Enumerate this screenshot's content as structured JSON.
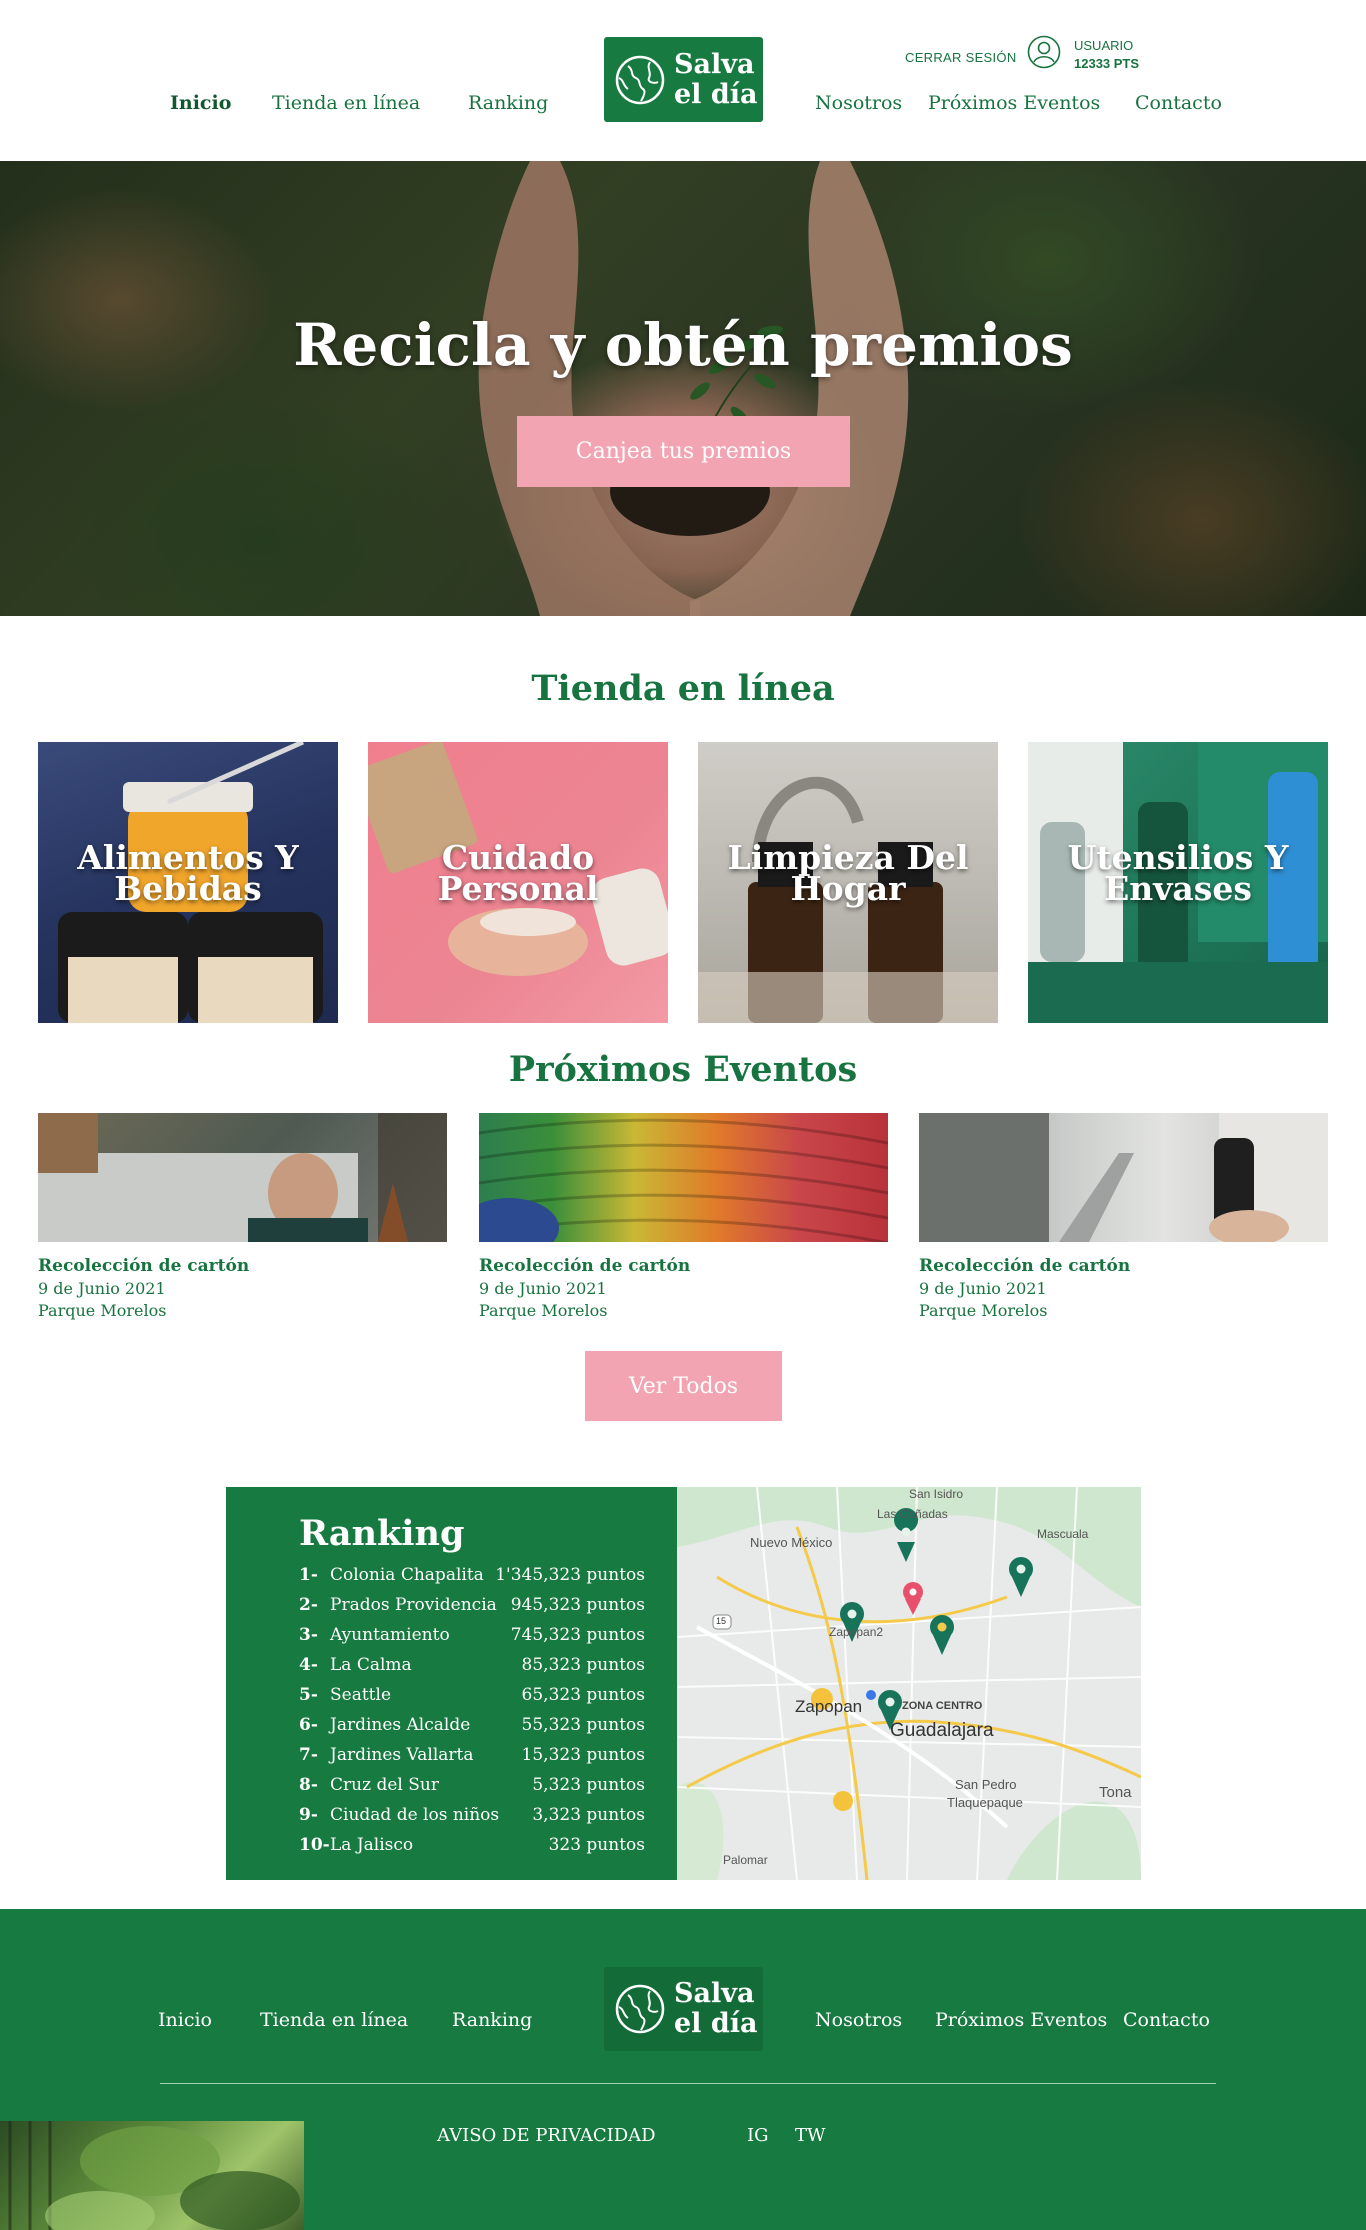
{
  "header": {
    "nav_left": [
      "Inicio",
      "Tienda en línea",
      "Ranking"
    ],
    "nav_right": [
      "Nosotros",
      "Próximos Eventos",
      "Contacto"
    ],
    "logo_line1": "Salva",
    "logo_line2": "el día",
    "logout_label": "CERRAR SESIÓN",
    "user_label": "USUARIO",
    "user_points": "12333 PTS",
    "user_icon": "user-circle-icon",
    "active_color": "#11572f"
  },
  "hero": {
    "title": "Recicla y obtén premios",
    "cta_label": "Canjea tus premios"
  },
  "store": {
    "title": "Tienda en línea",
    "categories": [
      "Alimentos Y Bebidas",
      "Cuidado Personal",
      "Limpieza Del Hogar",
      "Utensilios Y Envases"
    ]
  },
  "events": {
    "title": "Próximos Eventos",
    "items": [
      {
        "title": "Recolección de cartón",
        "date": "9 de Junio 2021",
        "place": "Parque Morelos"
      },
      {
        "title": "Recolección de cartón",
        "date": "9 de Junio 2021",
        "place": "Parque Morelos"
      },
      {
        "title": "Recolección de cartón",
        "date": "9 de Junio 2021",
        "place": "Parque Morelos"
      }
    ],
    "see_all_label": "Ver Todos"
  },
  "ranking": {
    "title": "Ranking",
    "rows": [
      {
        "num": "1-",
        "name": "Colonia Chapalita",
        "points": "1'345,323 puntos"
      },
      {
        "num": "2-",
        "name": "Prados Providencia",
        "points": "945,323 puntos"
      },
      {
        "num": "3-",
        "name": "Ayuntamiento",
        "points": "745,323 puntos"
      },
      {
        "num": "4-",
        "name": "La Calma",
        "points": "85,323 puntos"
      },
      {
        "num": "5-",
        "name": "Seattle",
        "points": "65,323 puntos"
      },
      {
        "num": "6-",
        "name": "Jardines Alcalde",
        "points": "55,323 puntos"
      },
      {
        "num": "7-",
        "name": "Jardines Vallarta",
        "points": "15,323 puntos"
      },
      {
        "num": "8-",
        "name": "Cruz del Sur",
        "points": "5,323 puntos"
      },
      {
        "num": "9-",
        "name": "Ciudad de los niños",
        "points": "3,323 puntos"
      },
      {
        "num": "10-",
        "name": "La Jalisco",
        "points": "323 puntos"
      }
    ]
  },
  "map": {
    "labels": [
      "San Isidro",
      "Las Cañadas",
      "Nuevo México",
      "Mascuala",
      "Zapopan2",
      "Zapopan",
      "ZONA CENTRO",
      "Guadalajara",
      "San Pedro",
      "Tlaquepaque",
      "Tona",
      "Palomar",
      "15"
    ]
  },
  "footer": {
    "nav_left": [
      "Inicio",
      "Tienda en línea",
      "Ranking"
    ],
    "nav_right": [
      "Nosotros",
      "Próximos Eventos",
      "Contacto"
    ],
    "logo_line1": "Salva",
    "logo_line2": "el día",
    "privacy_label": "AVISO DE PRIVACIDAD",
    "social": [
      "IG",
      "TW"
    ]
  },
  "colors": {
    "brand_green": "#177a40",
    "accent_pink": "#f3a4b2"
  }
}
